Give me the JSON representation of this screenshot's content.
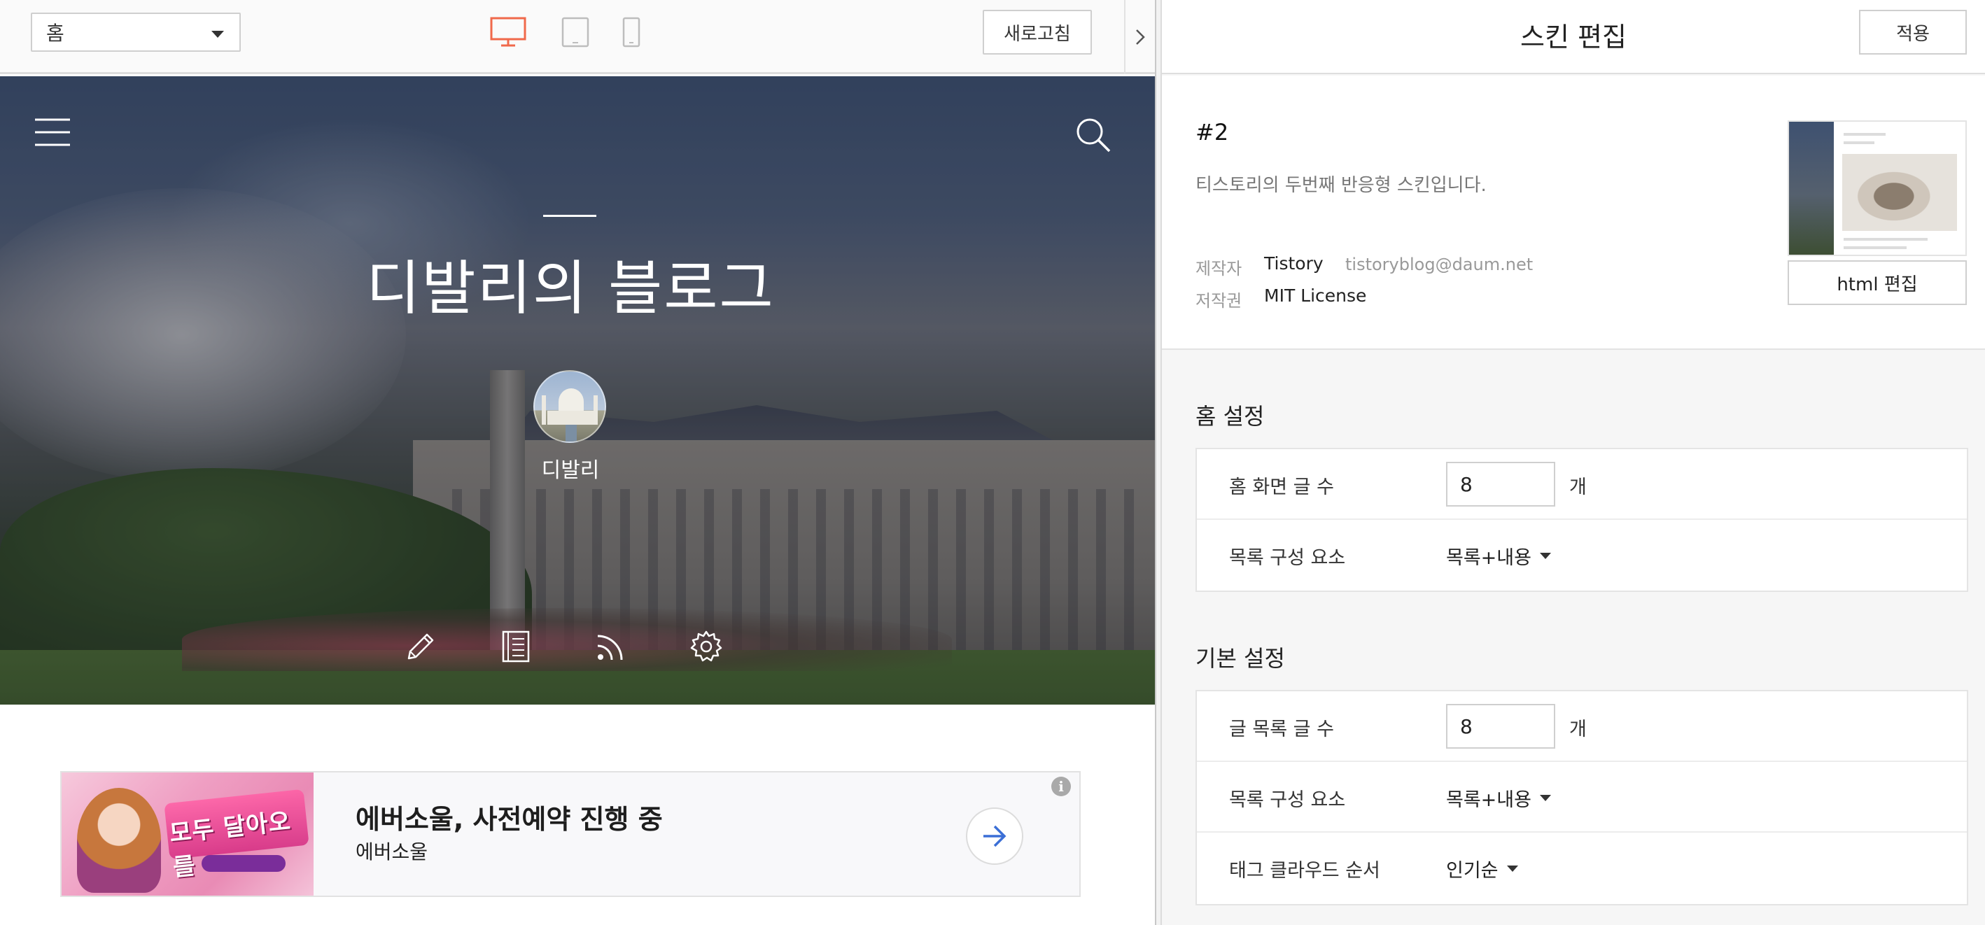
{
  "preview_toolbar": {
    "page_select": "홈",
    "refresh_label": "새로고침",
    "collapse_icon": "chevron-right-icon",
    "devices": [
      "desktop-icon",
      "tablet-icon",
      "mobile-icon"
    ],
    "active_device_color": "#f0694b"
  },
  "blog": {
    "title": "디발리의 블로그",
    "author": "디발리"
  },
  "ad": {
    "image_text": "모두 달아오를",
    "title": "에버소울, 사전예약 진행 중",
    "subtitle": "에버소울",
    "info_icon": "i"
  },
  "editor": {
    "title": "스킨 편집",
    "apply_label": "적용",
    "skin": {
      "name": "#2",
      "description": "티스토리의 두번째 반응형 스킨입니다.",
      "author_label": "제작자",
      "author_value": "Tistory",
      "author_email": "tistoryblog@daum.net",
      "license_label": "저작권",
      "license_value": "MIT License",
      "html_edit_label": "html 편집"
    },
    "home_settings": {
      "title": "홈 설정",
      "rows": [
        {
          "label": "홈 화면 글 수",
          "value": "8",
          "unit": "개"
        },
        {
          "label": "목록 구성 요소",
          "value": "목록+내용"
        }
      ]
    },
    "basic_settings": {
      "title": "기본 설정",
      "rows": [
        {
          "label": "글 목록 글 수",
          "value": "8",
          "unit": "개"
        },
        {
          "label": "목록 구성 요소",
          "value": "목록+내용"
        },
        {
          "label": "태그 클라우드 순서",
          "value": "인기순"
        }
      ]
    }
  }
}
